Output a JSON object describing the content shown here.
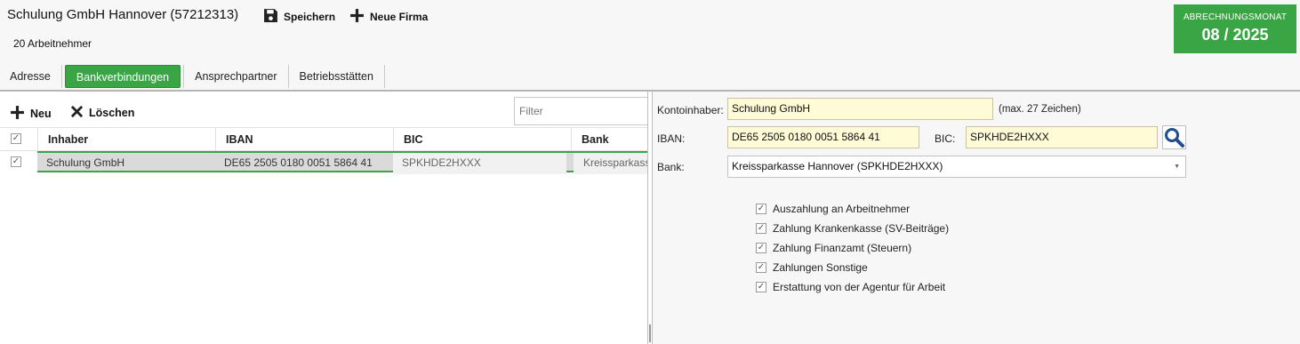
{
  "header": {
    "title": "Schulung GmbH Hannover (57212313)",
    "save_label": "Speichern",
    "new_company_label": "Neue Firma",
    "employees": "20 Arbeitnehmer"
  },
  "billing_month": {
    "label": "ABRECHNUNGSMONAT",
    "value": "08 / 2025"
  },
  "tabs": [
    {
      "label": "Adresse",
      "active": false
    },
    {
      "label": "Bankverbindungen",
      "active": true
    },
    {
      "label": "Ansprechpartner",
      "active": false
    },
    {
      "label": "Betriebsstätten",
      "active": false
    }
  ],
  "list": {
    "new_label": "Neu",
    "delete_label": "Löschen",
    "filter_placeholder": "Filter",
    "columns": [
      "Inhaber",
      "IBAN",
      "BIC",
      "Bank"
    ],
    "rows": [
      {
        "checked": true,
        "inhaber": "Schulung GmbH",
        "iban": "DE65 2505 0180 0051 5864 41",
        "bic": "SPKHDE2HXXX",
        "bank": "Kreissparkasse"
      }
    ]
  },
  "detail": {
    "kontoinhaber_label": "Kontoinhaber:",
    "kontoinhaber_value": "Schulung GmbH",
    "kontoinhaber_hint": "(max. 27 Zeichen)",
    "iban_label": "IBAN:",
    "iban_value": "DE65 2505 0180 0051 5864 41",
    "bic_label": "BIC:",
    "bic_value": "SPKHDE2HXXX",
    "bank_label": "Bank:",
    "bank_value": "Kreissparkasse Hannover (SPKHDE2HXXX)",
    "options": [
      {
        "label": "Auszahlung an Arbeitnehmer",
        "checked": true
      },
      {
        "label": "Zahlung Krankenkasse (SV-Beiträge)",
        "checked": true
      },
      {
        "label": "Zahlung Finanzamt (Steuern)",
        "checked": true
      },
      {
        "label": "Zahlungen Sonstige",
        "checked": true
      },
      {
        "label": "Erstattung von der Agentur für Arbeit",
        "checked": true
      }
    ]
  },
  "colors": {
    "accent": "#3aa545",
    "input_highlight": "#fefbd6"
  }
}
